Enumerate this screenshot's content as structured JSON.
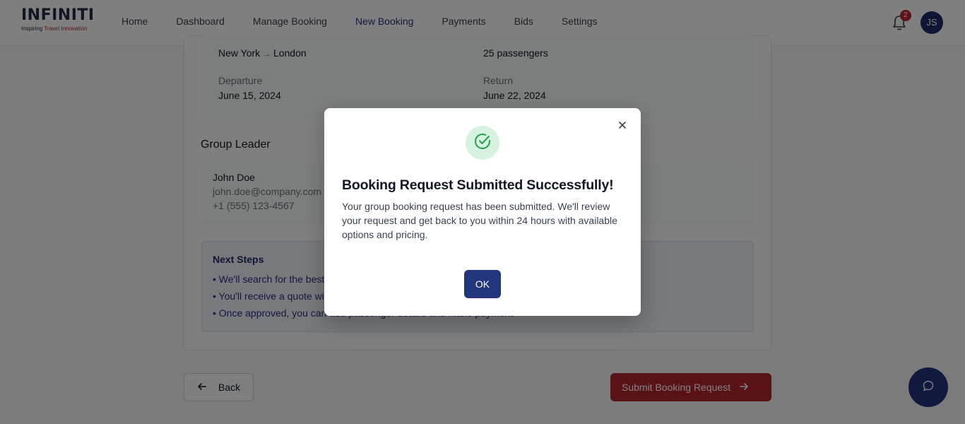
{
  "brand": {
    "name": "INFINITI",
    "tagline_prefix": "Inspiring ",
    "tagline_accent": "Travel Innovation"
  },
  "nav": [
    {
      "label": "Home"
    },
    {
      "label": "Dashboard"
    },
    {
      "label": "Manage Booking"
    },
    {
      "label": "New Booking",
      "active": true
    },
    {
      "label": "Payments"
    },
    {
      "label": "Bids"
    },
    {
      "label": "Settings"
    }
  ],
  "notifications": {
    "count": "2",
    "icon": "bell-icon"
  },
  "user": {
    "initials": "JS"
  },
  "trip": {
    "route_from": "New York",
    "route_arrow": "→",
    "route_to": "London",
    "passengers": "25 passengers",
    "departure_label": "Departure",
    "departure_date": "June 15, 2024",
    "return_label": "Return",
    "return_date": "June 22, 2024"
  },
  "group_leader": {
    "section_title": "Group Leader",
    "name": "John Doe",
    "email": "john.doe@company.com",
    "phone": "+1 (555) 123-4567"
  },
  "next_steps": {
    "title": "Next Steps",
    "items": [
      "• We'll search for the best available options for your group",
      "• You'll receive a quote within 24 hours",
      "• Once approved, you can add passenger details and make payment"
    ]
  },
  "actions": {
    "back_label": "Back",
    "submit_label": "Submit Booking Request"
  },
  "modal": {
    "title": "Booking Request Submitted Successfully!",
    "message": "Your group booking request has been submitted. We'll review your request and get back to you within 24 hours with available options and pricing.",
    "ok_label": "OK"
  },
  "colors": {
    "primary": "#23357c",
    "accent": "#b3262e",
    "success": "#22a04b",
    "success_bg": "#d7f3df"
  }
}
